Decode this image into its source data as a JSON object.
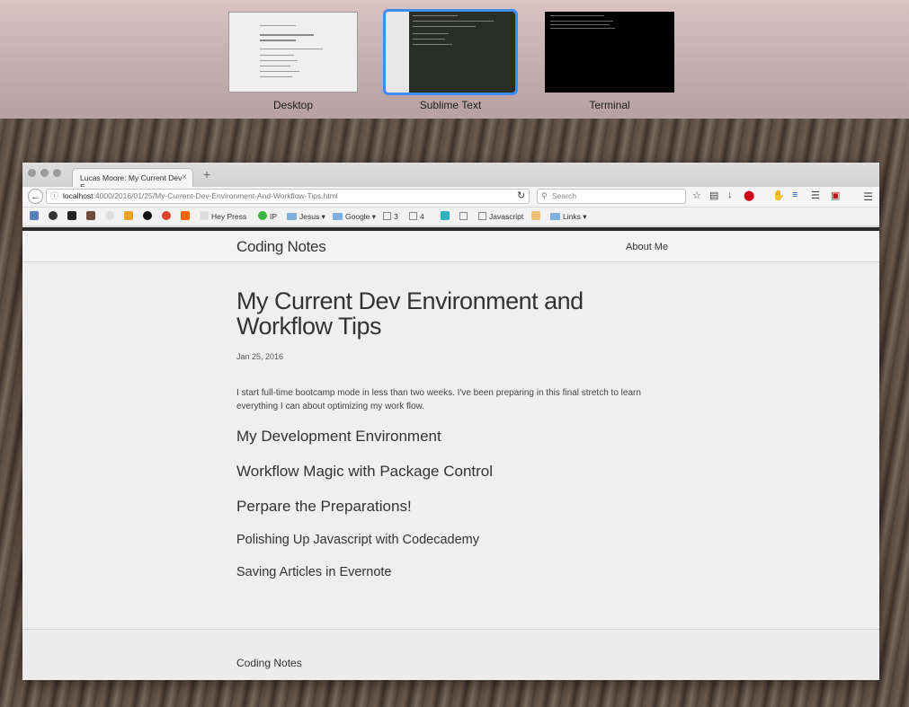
{
  "spaces": [
    {
      "label": "Desktop"
    },
    {
      "label": "Sublime Text"
    },
    {
      "label": "Terminal"
    }
  ],
  "browser": {
    "tab_title": "Lucas Moore: My Current Dev E...",
    "tab_close": "×",
    "new_tab": "+",
    "url_host": "localhost",
    "url_path": ":4000/2016/01/25/My-Current-Dev-Environment-And-Workflow-Tips.html",
    "search_placeholder": "Search",
    "bookmarks": {
      "hey_press": "Hey Press",
      "ip": "IP",
      "jesus": "Jesus",
      "google": "Google",
      "three": "3",
      "four": "4",
      "javascript": "Javascript",
      "links": "Links"
    }
  },
  "site": {
    "title": "Coding Notes",
    "nav_about": "About Me",
    "footer_title": "Coding Notes"
  },
  "post": {
    "title": "My Current Dev Environment and Workflow Tips",
    "date": "Jan 25, 2016",
    "intro": "I start full-time bootcamp mode in less than two weeks. I've been preparing in this final stretch to learn everything I can about optimizing my work flow.",
    "sections": [
      "My Development Environment",
      "Workflow Magic with Package Control",
      "Perpare the Preparations!",
      "Polishing Up Javascript with Codecademy",
      "Saving Articles in Evernote"
    ]
  }
}
